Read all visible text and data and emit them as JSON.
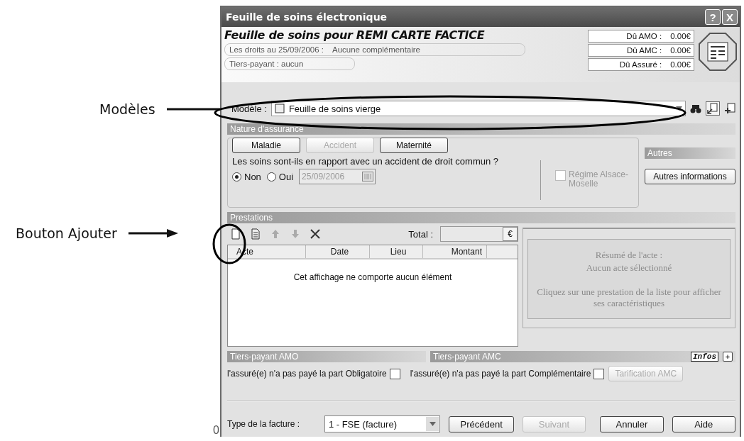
{
  "annotations": [
    {
      "label": "Modèles"
    },
    {
      "label": "Bouton Ajouter"
    }
  ],
  "window": {
    "title": "Feuille de soins électronique",
    "buttons": [
      "?",
      "X"
    ]
  },
  "patient": {
    "heading": "Feuille de soins pour REMI CARTE FACTICE",
    "rights_label": "Les droits au 25/09/2006 :",
    "rights_value": "Aucune complémentaire",
    "tiers_payant": "Tiers-payant : aucun"
  },
  "amounts": [
    {
      "label": "Dû AMO :",
      "value": "0.00€"
    },
    {
      "label": "Dû AMC :",
      "value": "0.00€"
    },
    {
      "label": "Dû Assuré :",
      "value": "0.00€"
    }
  ],
  "model": {
    "label": "Modèle :",
    "value": "Feuille de soins vierge"
  },
  "insurance": {
    "header": "Nature d'assurance",
    "types": [
      {
        "label": "Maladie",
        "disabled": false
      },
      {
        "label": "Accident",
        "disabled": true
      },
      {
        "label": "Maternité",
        "disabled": false
      }
    ],
    "question": "Les soins sont-ils en rapport avec un accident de droit commun ?",
    "options": [
      {
        "label": "Non",
        "selected": true
      },
      {
        "label": "Oui",
        "selected": false
      }
    ],
    "date": "25/09/2006",
    "date_disabled": true,
    "regime": {
      "label": "Régime Alsace-Moselle",
      "checked": false,
      "disabled": true
    }
  },
  "others": {
    "header": "Autres",
    "button": "Autres informations"
  },
  "prestations": {
    "header": "Prestations",
    "toolbar": [
      {
        "kind": "new",
        "disabled": false
      },
      {
        "kind": "copy",
        "disabled": false
      },
      {
        "kind": "up",
        "disabled": true
      },
      {
        "kind": "down",
        "disabled": true
      },
      {
        "kind": "delete",
        "disabled": false
      }
    ],
    "total_label": "Total :",
    "currency": "€",
    "columns": [
      "Acte",
      "Date",
      "Lieu",
      "Montant"
    ],
    "empty": "Cet affichage ne comporte aucun élément",
    "summary": {
      "title": "Résumé de l'acte :",
      "subtitle": "Aucun acte sélectionné",
      "hint": "Cliquez sur une prestation de la liste pour afficher ses caractéristiques"
    }
  },
  "tiers_payant": [
    {
      "header": "Tiers-payant AMO",
      "label": "l'assuré(e) n'a pas payé la part Obligatoire",
      "checked": false
    },
    {
      "header": "Tiers-payant AMC",
      "label": "l'assuré(e) n'a pas payé la part Complémentaire",
      "checked": false
    }
  ],
  "infos": {
    "label": "Infos",
    "plus": "+"
  },
  "tarification": {
    "label": "Tarification AMC",
    "disabled": true
  },
  "invoice": {
    "label": "Type de la facture :",
    "value": "1 - FSE (facture)"
  },
  "buttons": [
    {
      "label": "Précédent",
      "disabled": false
    },
    {
      "label": "Suivant",
      "disabled": true
    },
    {
      "label": "Annuler",
      "disabled": false
    },
    {
      "label": "Aide",
      "disabled": false
    }
  ],
  "stray": "0"
}
